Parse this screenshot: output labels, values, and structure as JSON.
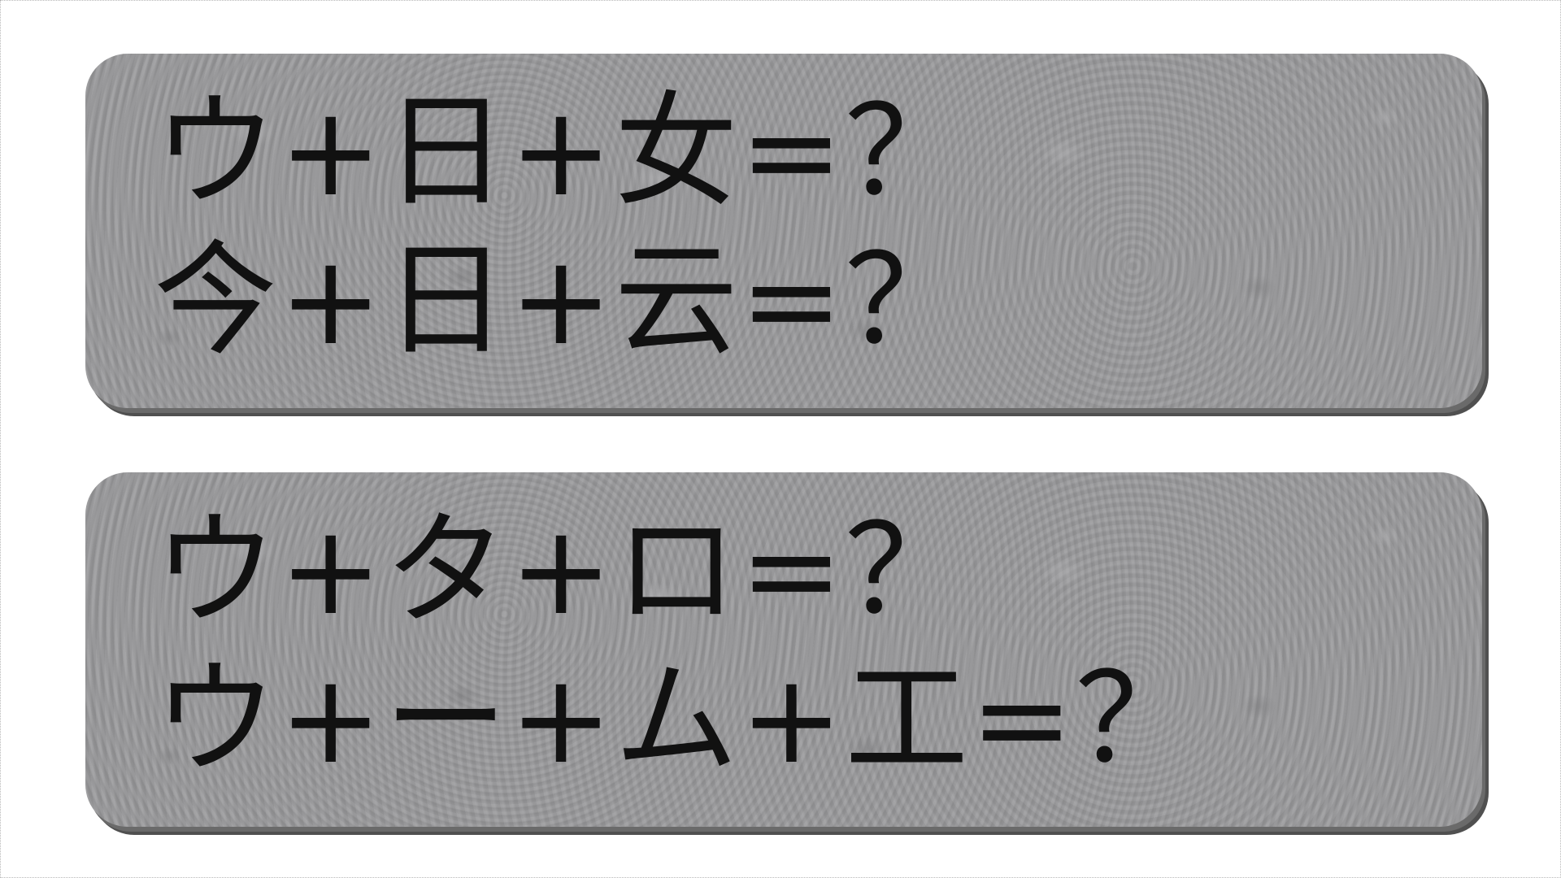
{
  "puzzles": [
    {
      "lines": [
        "ウ+日+女=？",
        "今+日+云=？"
      ]
    },
    {
      "lines": [
        "ウ+タ+ロ=？",
        "ウ+ー+ム+工=？"
      ]
    }
  ],
  "colors": {
    "card_background": "#9a9a9c",
    "card_shadow": "#505050",
    "text": "#111111",
    "page_background": "#ffffff"
  }
}
